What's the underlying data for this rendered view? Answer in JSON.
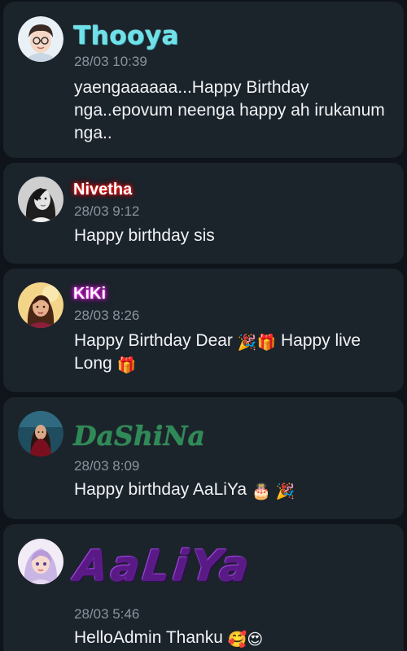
{
  "comments": [
    {
      "name": "Thooya",
      "time": "28/03 10:39",
      "message": "yaengaaaaaa...Happy Birthday nga..epovum neenga happy ah irukanum nga..",
      "emojis": []
    },
    {
      "name": "Nivetha",
      "time": "28/03 9:12",
      "message": "Happy birthday sis",
      "emojis": []
    },
    {
      "name": "KiKi",
      "time": "28/03 8:26",
      "message_part1": "Happy Birthday Dear",
      "emoji_a": "🎉",
      "emoji_b": "🎁",
      "message_part2": "Happy live Long",
      "emoji_c": "🎁"
    },
    {
      "name": "DaShiNa",
      "time": "28/03 8:09",
      "message": "Happy birthday AaLiYa",
      "emoji_a": "🎂",
      "emoji_b": "🎉"
    },
    {
      "name": "AaLiYa",
      "time": "28/03 5:46",
      "message": "HelloAdmin Thanku",
      "emoji_a": "🥰",
      "emoji_b": "😍"
    }
  ],
  "avatars": [
    {
      "icon": "cartoon-boy-avatar-icon"
    },
    {
      "icon": "woman-bw-avatar-icon"
    },
    {
      "icon": "woman-portrait-avatar-icon"
    },
    {
      "icon": "woman-red-dress-avatar-icon"
    },
    {
      "icon": "cartoon-girl-avatar-icon"
    }
  ]
}
